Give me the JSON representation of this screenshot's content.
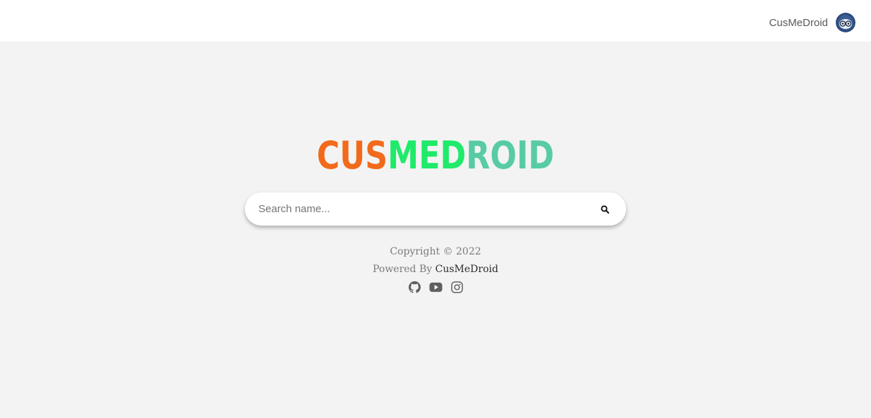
{
  "header": {
    "username": "CusMeDroid",
    "avatar_icon": "owl-avatar-icon",
    "avatar_color": "#2d4a7a"
  },
  "logo": {
    "parts": [
      {
        "text": "CUS",
        "color": "#f26a1b"
      },
      {
        "text": "MED",
        "color": "#1fea6a"
      },
      {
        "text": "ROID",
        "color": "#58cba5"
      }
    ]
  },
  "search": {
    "placeholder": "Search name...",
    "value": "",
    "button_icon": "search-icon"
  },
  "footer": {
    "copyright": "Copyright © 2022",
    "powered_prefix": "Powered By ",
    "powered_brand": "CusMeDroid",
    "social_icons": [
      "github-icon",
      "youtube-icon",
      "instagram-icon"
    ]
  }
}
